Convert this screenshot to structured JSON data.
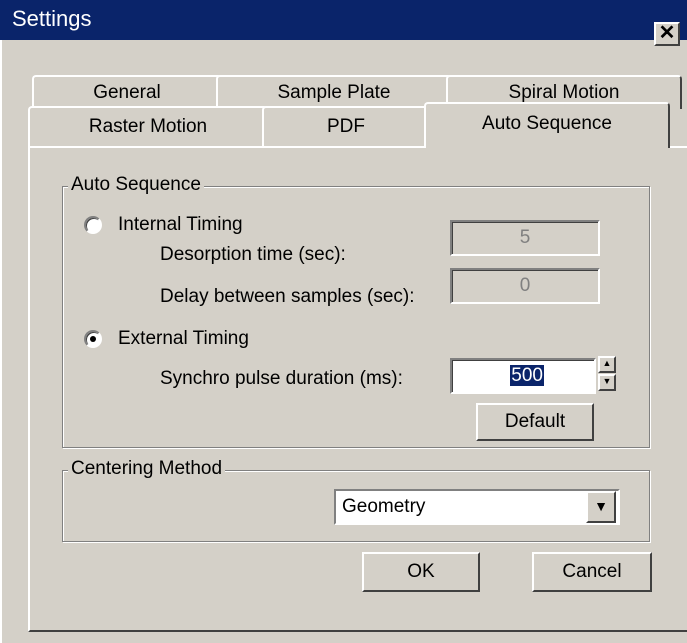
{
  "window": {
    "title": "Settings",
    "close_glyph": "✕",
    "close_icon": "close-icon"
  },
  "tabs": {
    "row1": [
      {
        "label": "General"
      },
      {
        "label": "Sample Plate"
      },
      {
        "label": "Spiral Motion"
      }
    ],
    "row2": [
      {
        "label": "Raster Motion"
      },
      {
        "label": "PDF"
      },
      {
        "label": "Auto Sequence",
        "active": true
      }
    ]
  },
  "auto_sequence": {
    "group_label": "Auto Sequence",
    "internal_timing": {
      "label": "Internal Timing",
      "selected": false,
      "desorption_label": "Desorption time (sec):",
      "desorption_value": "5",
      "delay_label": "Delay between samples (sec):",
      "delay_value": "0"
    },
    "external_timing": {
      "label": "External Timing",
      "selected": true,
      "pulse_label": "Synchro pulse duration (ms):",
      "pulse_value": "500",
      "spin_up": "▲",
      "spin_down": "▼"
    },
    "default_button": "Default"
  },
  "centering": {
    "group_label": "Centering Method",
    "selected": "Geometry",
    "dropdown_glyph": "▼"
  },
  "buttons": {
    "ok": "OK",
    "cancel": "Cancel"
  }
}
